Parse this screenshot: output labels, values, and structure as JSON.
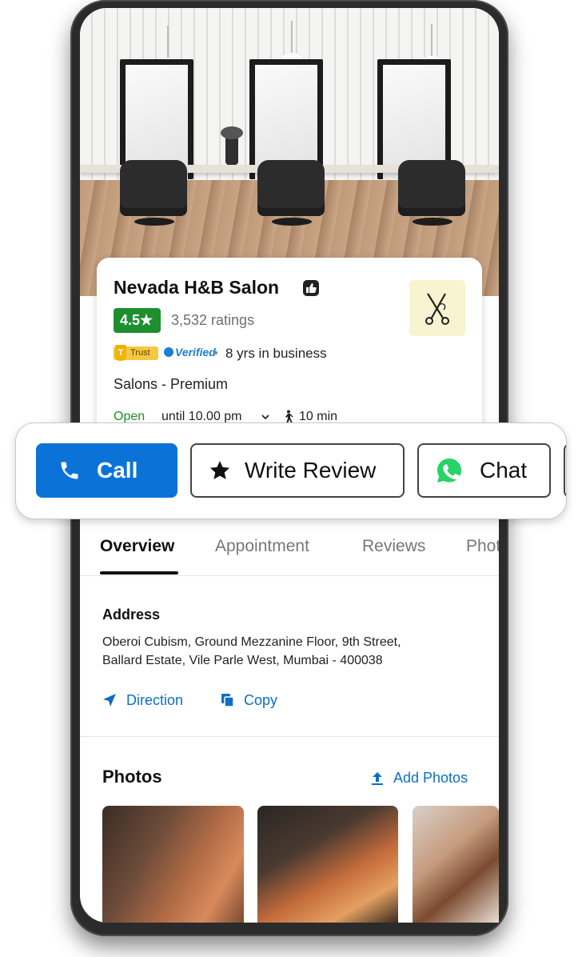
{
  "business": {
    "name": "Nevada H&B Salon",
    "rating": "4.5★",
    "ratings_count": "3,532 ratings",
    "trust_label": "Trust",
    "verified_label": "Verified",
    "separator": "•",
    "years_in_business": "8 yrs in business",
    "category": "Salons - Premium",
    "open_status": "Open",
    "open_until": "until 10.00 pm",
    "distance": "10 min"
  },
  "actions": {
    "call_label": "Call",
    "review_label": "Write Review",
    "chat_label": "Chat"
  },
  "tabs": [
    {
      "label": "Overview",
      "active": true
    },
    {
      "label": "Appointment",
      "active": false
    },
    {
      "label": "Reviews",
      "active": false
    },
    {
      "label": "Photos",
      "active": false
    }
  ],
  "address": {
    "title": "Address",
    "line1": "Oberoi Cubism, Ground Mezzanine Floor, 9th Street,",
    "line2": "Ballard Estate, Vile Parle West, Mumbai - 400038",
    "direction_label": "Direction",
    "copy_label": "Copy"
  },
  "photos": {
    "title": "Photos",
    "add_label": "Add Photos"
  },
  "colors": {
    "primary": "#0b73d8",
    "rating_green": "#1e8e2e",
    "link_blue": "#0b6fc9",
    "whatsapp_green": "#25d366"
  }
}
